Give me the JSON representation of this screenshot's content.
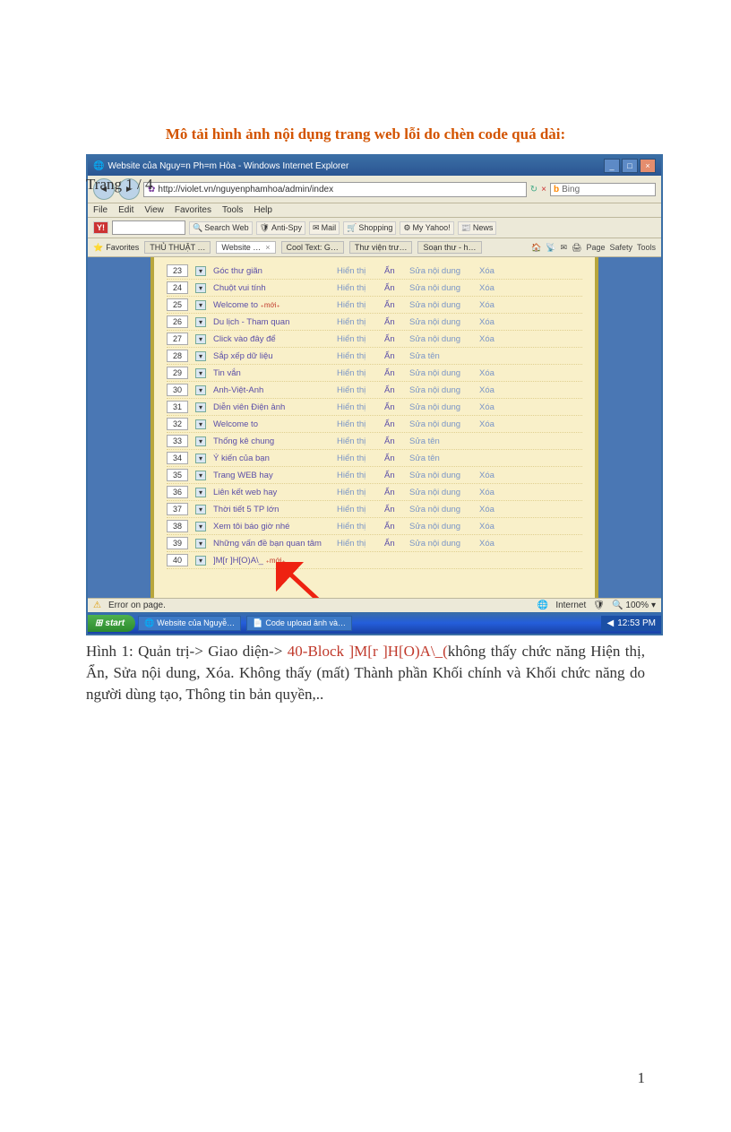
{
  "page_header": "Trang 1 / 4",
  "title": "Mô tải hình ảnh nội dụng trang web lỗi do chèn code quá dài:",
  "ie": {
    "window_title": "Website của Nguy=n Ph=m Hòa - Windows Internet Explorer",
    "url": "http://violet.vn/nguyenphamhoa/admin/index",
    "search_placeholder": "Bing",
    "menu": [
      "File",
      "Edit",
      "View",
      "Favorites",
      "Tools",
      "Help"
    ],
    "toolbar": {
      "y_label": "Y!",
      "search_label": "Search Web",
      "anti_spy": "Anti-Spy",
      "mail": "Mail",
      "shopping": "Shopping",
      "my_yahoo": "My Yahoo!",
      "news": "News"
    },
    "favorites_label": "Favorites",
    "tabs": [
      {
        "label": "THỦ THUẬT …"
      },
      {
        "label": "Website …"
      },
      {
        "label": "Cool Text: G…"
      },
      {
        "label": "Thư viện trư…"
      },
      {
        "label": "Soạn thư - h…"
      }
    ],
    "page_tools": [
      "Page",
      "Safety",
      "Tools"
    ],
    "status_left": "Error on page.",
    "status_net": "Internet",
    "zoom": "100%"
  },
  "taskbar": {
    "start": "start",
    "tasks": [
      "Website của Nguyễ…",
      "Code upload ảnh và…"
    ],
    "clock": "12:53 PM"
  },
  "rows": [
    {
      "n": "23",
      "name": "Góc thư giãn",
      "hien": "Hiển thị",
      "an": "Ẩn",
      "sua": "Sửa nội dung",
      "xoa": "Xóa"
    },
    {
      "n": "24",
      "name": "Chuột vui tính",
      "hien": "Hiển thị",
      "an": "Ẩn",
      "sua": "Sửa nội dung",
      "xoa": "Xóa"
    },
    {
      "n": "25",
      "name": "Welcome to",
      "moi": true,
      "hien": "Hiển thị",
      "an": "Ẩn",
      "sua": "Sửa nội dung",
      "xoa": "Xóa"
    },
    {
      "n": "26",
      "name": "Du lịch - Tham quan",
      "hien": "Hiển thị",
      "an": "Ẩn",
      "sua": "Sửa nội dung",
      "xoa": "Xóa"
    },
    {
      "n": "27",
      "name": "Click vào đây để",
      "hien": "Hiển thị",
      "an": "Ẩn",
      "sua": "Sửa nội dung",
      "xoa": "Xóa"
    },
    {
      "n": "28",
      "name": "Sắp xếp dữ liệu",
      "hien": "Hiển thị",
      "an": "Ẩn",
      "sua": "Sửa tên",
      "xoa": ""
    },
    {
      "n": "29",
      "name": "Tin vắn",
      "hien": "Hiển thị",
      "an": "Ẩn",
      "sua": "Sửa nội dung",
      "xoa": "Xóa"
    },
    {
      "n": "30",
      "name": "Anh-Việt-Anh",
      "hien": "Hiển thị",
      "an": "Ẩn",
      "sua": "Sửa nội dung",
      "xoa": "Xóa"
    },
    {
      "n": "31",
      "name": "Diễn viên Điện ảnh",
      "hien": "Hiển thị",
      "an": "Ẩn",
      "sua": "Sửa nội dung",
      "xoa": "Xóa"
    },
    {
      "n": "32",
      "name": "Welcome to",
      "hien": "Hiển thị",
      "an": "Ẩn",
      "sua": "Sửa nội dung",
      "xoa": "Xóa"
    },
    {
      "n": "33",
      "name": "Thống kê chung",
      "hien": "Hiển thị",
      "an": "Ẩn",
      "sua": "Sửa tên",
      "xoa": ""
    },
    {
      "n": "34",
      "name": "Ý kiến của bạn",
      "hien": "Hiển thị",
      "an": "Ẩn",
      "sua": "Sửa tên",
      "xoa": ""
    },
    {
      "n": "35",
      "name": "Trang WEB hay",
      "hien": "Hiển thị",
      "an": "Ẩn",
      "sua": "Sửa nội dung",
      "xoa": "Xóa"
    },
    {
      "n": "36",
      "name": "Liên kết web hay",
      "hien": "Hiển thị",
      "an": "Ẩn",
      "sua": "Sửa nội dung",
      "xoa": "Xóa"
    },
    {
      "n": "37",
      "name": "Thời tiết 5 TP lớn",
      "hien": "Hiển thị",
      "an": "Ẩn",
      "sua": "Sửa nội dung",
      "xoa": "Xóa"
    },
    {
      "n": "38",
      "name": "Xem tôi báo giờ nhé",
      "hien": "Hiển thị",
      "an": "Ẩn",
      "sua": "Sửa nội dung",
      "xoa": "Xóa"
    },
    {
      "n": "39",
      "name": "Những vấn đề bạn quan tâm",
      "hien": "Hiển thị",
      "an": "Ẩn",
      "sua": "Sửa nội dung",
      "xoa": "Xóa"
    },
    {
      "n": "40",
      "name": "]M[r ]H[O)A\\_",
      "moi": true,
      "hien": "",
      "an": "",
      "sua": "",
      "xoa": ""
    }
  ],
  "caption": {
    "prefix": "Hình 1: Quản trị-> Giao diện-> ",
    "red": "40-Block ]M[r ]H[O)A\\_(",
    "suffix": "không thấy chức năng Hiện thị, Ẩn, Sửa nội dung, Xóa. Không thấy (mất) Thành phần Khối chính và Khối chức năng do người dùng tạo, Thông tin bản quyền,.."
  },
  "page_num": "1"
}
